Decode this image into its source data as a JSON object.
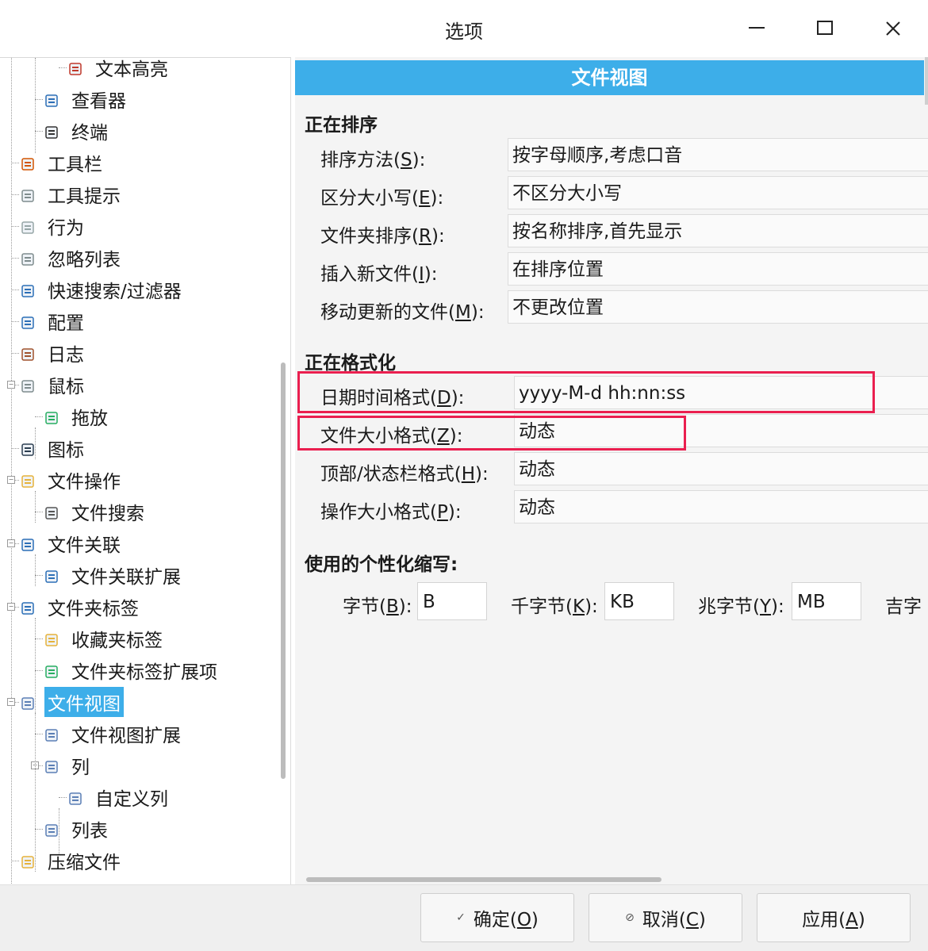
{
  "window": {
    "title": "选项",
    "controls": {
      "minimize": "—",
      "maximize": "☐",
      "close": "✕"
    }
  },
  "tree": {
    "items": [
      {
        "label": "文本高亮",
        "icon": "document-text-icon",
        "level": 3
      },
      {
        "label": "查看器",
        "icon": "viewer-book-icon",
        "level": 2
      },
      {
        "label": "终端",
        "icon": "terminal-icon",
        "level": 2
      },
      {
        "label": "工具栏",
        "icon": "toolbar-scissors-icon",
        "level": 1
      },
      {
        "label": "工具提示",
        "icon": "lightbulb-icon",
        "level": 1
      },
      {
        "label": "行为",
        "icon": "behavior-icon",
        "level": 1
      },
      {
        "label": "忽略列表",
        "icon": "ignore-list-icon",
        "level": 1
      },
      {
        "label": "快速搜索/过滤器",
        "icon": "quick-search-icon",
        "level": 1
      },
      {
        "label": "配置",
        "icon": "config-icon",
        "level": 1
      },
      {
        "label": "日志",
        "icon": "log-icon",
        "level": 1
      },
      {
        "label": "鼠标",
        "icon": "mouse-icon",
        "level": 1,
        "expandable": true
      },
      {
        "label": "拖放",
        "icon": "drag-drop-icon",
        "level": 2
      },
      {
        "label": "图标",
        "icon": "footprints-icon",
        "level": 1
      },
      {
        "label": "文件操作",
        "icon": "folder-icon",
        "level": 1,
        "expandable": true
      },
      {
        "label": "文件搜索",
        "icon": "binoculars-icon",
        "level": 2
      },
      {
        "label": "文件关联",
        "icon": "file-association-icon",
        "level": 1,
        "expandable": true
      },
      {
        "label": "文件关联扩展",
        "icon": "file-association-ext-icon",
        "level": 2
      },
      {
        "label": "文件夹标签",
        "icon": "folder-tabs-icon",
        "level": 1,
        "expandable": true
      },
      {
        "label": "收藏夹标签",
        "icon": "favorites-tab-icon",
        "level": 2
      },
      {
        "label": "文件夹标签扩展项",
        "icon": "folder-tab-ext-icon",
        "level": 2
      },
      {
        "label": "文件视图",
        "icon": "file-view-icon",
        "level": 1,
        "expandable": true,
        "selected": true
      },
      {
        "label": "文件视图扩展",
        "icon": "file-view-ext-icon",
        "level": 2
      },
      {
        "label": "列",
        "icon": "columns-icon",
        "level": 2,
        "expandable": true
      },
      {
        "label": "自定义列",
        "icon": "custom-columns-icon",
        "level": 3
      },
      {
        "label": "列表",
        "icon": "list-icon",
        "level": 2
      },
      {
        "label": "压缩文件",
        "icon": "archive-icon",
        "level": 1
      }
    ]
  },
  "content": {
    "banner": "文件视图",
    "sorting": {
      "title": "正在排序",
      "rows": [
        {
          "label_pre": "排序方法(",
          "key": "S",
          "label_post": "):",
          "value": "按字母顺序,考虑口音"
        },
        {
          "label_pre": "区分大小写(",
          "key": "E",
          "label_post": "):",
          "value": "不区分大小写"
        },
        {
          "label_pre": "文件夹排序(",
          "key": "R",
          "label_post": "):",
          "value": "按名称排序,首先显示"
        },
        {
          "label_pre": "插入新文件(",
          "key": "I",
          "label_post": "):",
          "value": "在排序位置"
        },
        {
          "label_pre": "移动更新的文件(",
          "key": "M",
          "label_post": "):",
          "value": "不更改位置"
        }
      ]
    },
    "formatting": {
      "title": "正在格式化",
      "rows": [
        {
          "label_pre": "日期时间格式(",
          "key": "D",
          "label_post": "):",
          "value": "yyyy-M-d hh:nn:ss"
        },
        {
          "label_pre": "文件大小格式(",
          "key": "Z",
          "label_post": "):",
          "value": "动态"
        },
        {
          "label_pre": "顶部/状态栏格式(",
          "key": "H",
          "label_post": "):",
          "value": "动态"
        },
        {
          "label_pre": "操作大小格式(",
          "key": "P",
          "label_post": "):",
          "value": "动态"
        }
      ]
    },
    "abbreviations": {
      "title": "使用的个性化缩写:",
      "items": [
        {
          "label_pre": "字节(",
          "key": "B",
          "label_post": "):",
          "value": "B"
        },
        {
          "label_pre": "千字节(",
          "key": "K",
          "label_post": "):",
          "value": "KB"
        },
        {
          "label_pre": "兆字节(",
          "key": "Y",
          "label_post": "):",
          "value": "MB"
        },
        {
          "label_pre": "吉字",
          "key": "",
          "label_post": "",
          "value": ""
        }
      ]
    }
  },
  "footer": {
    "ok": {
      "label_pre": "确定(",
      "key": "O",
      "label_post": ")",
      "icon": "✓"
    },
    "cancel": {
      "label_pre": "取消(",
      "key": "C",
      "label_post": ")",
      "icon": "⊘"
    },
    "apply": {
      "label_pre": "应用(",
      "key": "A",
      "label_post": ")"
    }
  },
  "colors": {
    "accent": "#3daee9",
    "highlight_box": "#ea1f4f"
  }
}
